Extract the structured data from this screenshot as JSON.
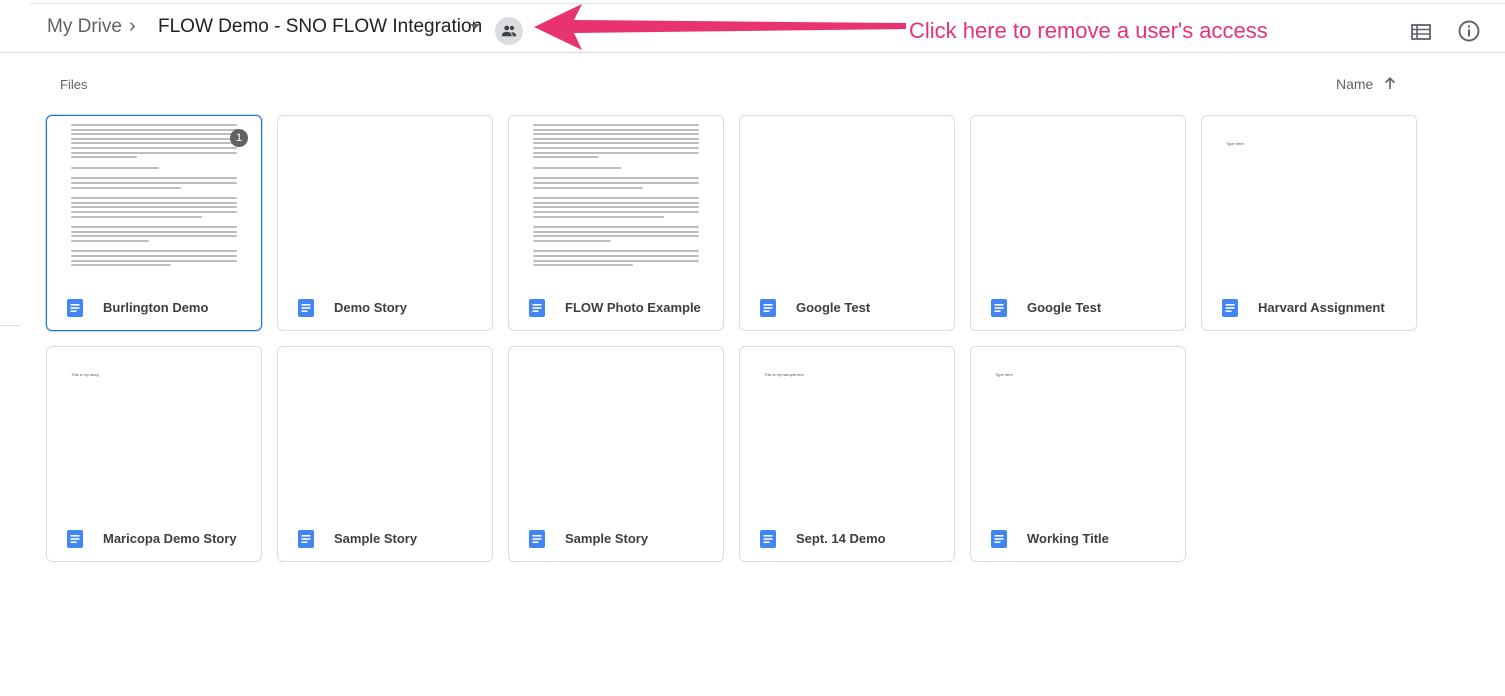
{
  "breadcrumb": {
    "root": "My Drive",
    "separator": "›",
    "current": "FLOW Demo - SNO FLOW Integration"
  },
  "annotation": {
    "text": "Click here to remove a user's access",
    "color": "#e8336f"
  },
  "icons": {
    "share": "people-icon",
    "list_view": "list-view-icon",
    "info": "info-icon",
    "sort": "arrow-up-icon",
    "doc": "google-docs-icon"
  },
  "section": {
    "label": "Files",
    "sort_label": "Name"
  },
  "colors": {
    "doc_blue": "#4285f4",
    "selected_border": "#1a73e8",
    "annotation": "#e8336f"
  },
  "files": [
    {
      "title": "Burlington Demo",
      "preview": "full-text",
      "badge": "1",
      "selected": true
    },
    {
      "title": "Demo Story",
      "preview": "blank"
    },
    {
      "title": "FLOW Photo Example",
      "preview": "full-text"
    },
    {
      "title": "Google Test",
      "preview": "blank"
    },
    {
      "title": "Google Test",
      "preview": "blank"
    },
    {
      "title": "Harvard Assignment",
      "preview": "short",
      "preview_text": "Type here"
    },
    {
      "title": "Maricopa Demo Story",
      "preview": "short",
      "preview_text": "This is my story"
    },
    {
      "title": "Sample Story",
      "preview": "blank"
    },
    {
      "title": "Sample Story",
      "preview": "blank"
    },
    {
      "title": "Sept. 14 Demo",
      "preview": "short",
      "preview_text": "This is my sample text"
    },
    {
      "title": "Working Title",
      "preview": "short",
      "preview_text": "Type here"
    }
  ]
}
